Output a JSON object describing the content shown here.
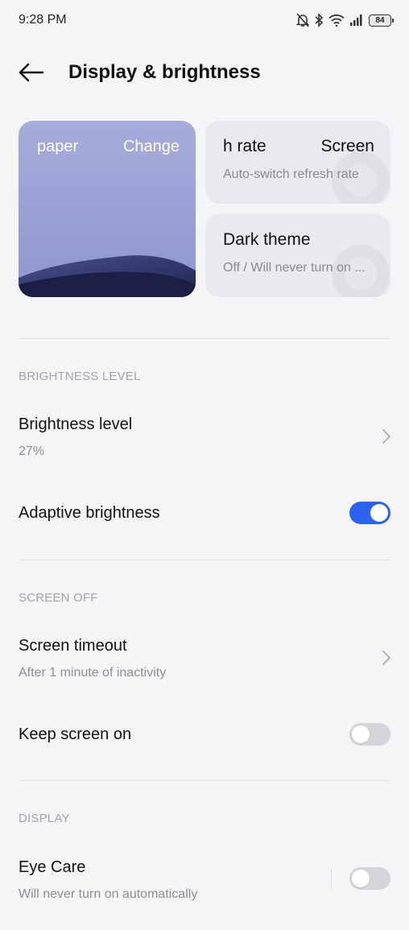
{
  "status_bar": {
    "time": "9:28 PM",
    "battery": "84",
    "icons": [
      "bell-muted-icon",
      "bluetooth-icon",
      "wifi-icon",
      "cellular-signal-icon",
      "battery-icon"
    ]
  },
  "header": {
    "title": "Display & brightness",
    "back_icon": "back-arrow-icon"
  },
  "cards": {
    "wallpaper": {
      "left_text": "paper",
      "right_text": "Change"
    },
    "refresh_rate": {
      "title_left": "h rate",
      "title_right": "Screen",
      "subtitle": "Auto-switch refresh rate"
    },
    "dark_theme": {
      "title": "Dark theme",
      "subtitle": "Off / Will never turn on ..."
    }
  },
  "sections": {
    "brightness": {
      "label": "BRIGHTNESS LEVEL",
      "brightness_level": {
        "title": "Brightness level",
        "value": "27%"
      },
      "adaptive": {
        "title": "Adaptive brightness",
        "enabled": true
      }
    },
    "screen_off": {
      "label": "SCREEN OFF",
      "timeout": {
        "title": "Screen timeout",
        "value": "After 1 minute of inactivity"
      },
      "keep_on": {
        "title": "Keep screen on",
        "enabled": false
      }
    },
    "display": {
      "label": "DISPLAY",
      "eye_care": {
        "title": "Eye Care",
        "value": "Will never turn on automatically",
        "enabled": false
      }
    }
  },
  "colors": {
    "accent": "#2b62f0",
    "background": "#f5f5f7",
    "card": "#e9eaef"
  }
}
